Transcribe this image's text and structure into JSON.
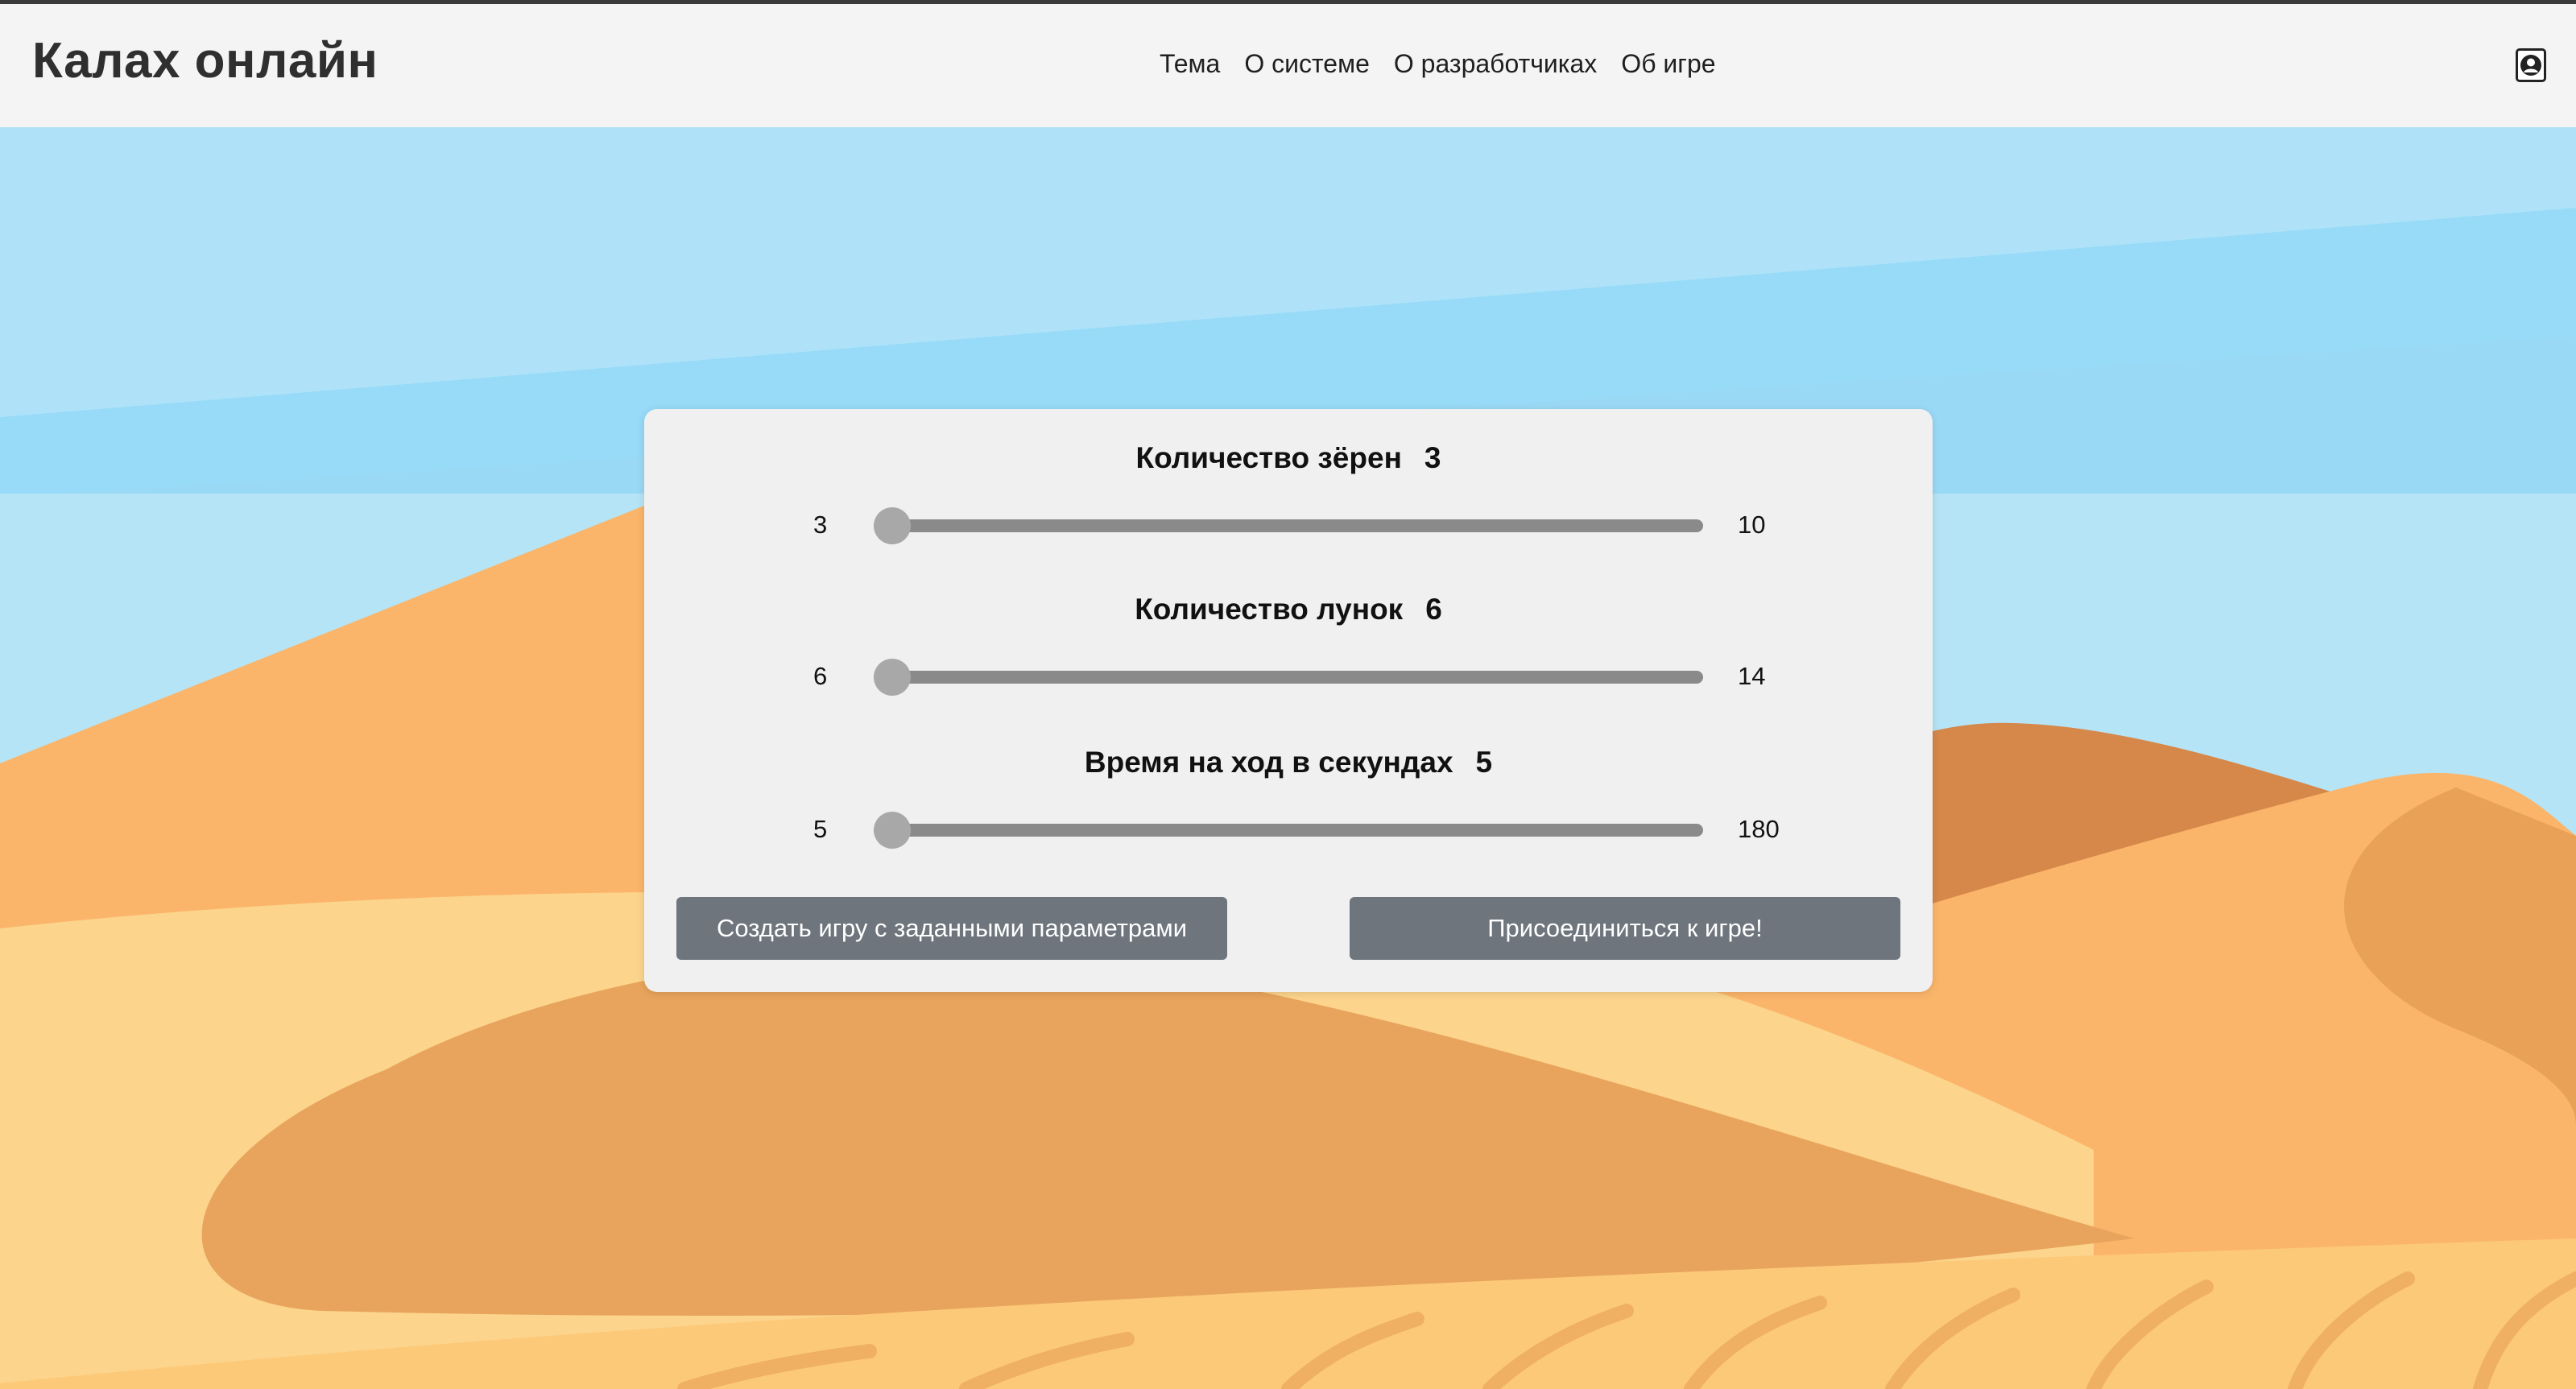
{
  "app": {
    "title": "Калах онлайн"
  },
  "nav": {
    "links": [
      {
        "label": "Тема"
      },
      {
        "label": "О системе"
      },
      {
        "label": "О разработчиках"
      },
      {
        "label": "Об игре"
      }
    ],
    "account_icon": "user-circle-icon"
  },
  "settings": {
    "seeds": {
      "label": "Количество зёрен",
      "value": "3",
      "min": "3",
      "max": "10"
    },
    "pits": {
      "label": "Количество лунок",
      "value": "6",
      "min": "6",
      "max": "14"
    },
    "time": {
      "label": "Время на ход в секундах",
      "value": "5",
      "min": "5",
      "max": "180"
    }
  },
  "actions": {
    "create_label": "Создать игру с заданными параметрами",
    "join_label": "Присоединиться к игре!"
  },
  "colors": {
    "navbar_bg": "#f4f4f4",
    "sky": "#abe0f7",
    "sand_light": "#fcd48c",
    "sand_mid": "#fbb56a",
    "sand_dark": "#d6874a",
    "button_bg": "#6e757c",
    "panel_bg": "#f0f0f0"
  }
}
